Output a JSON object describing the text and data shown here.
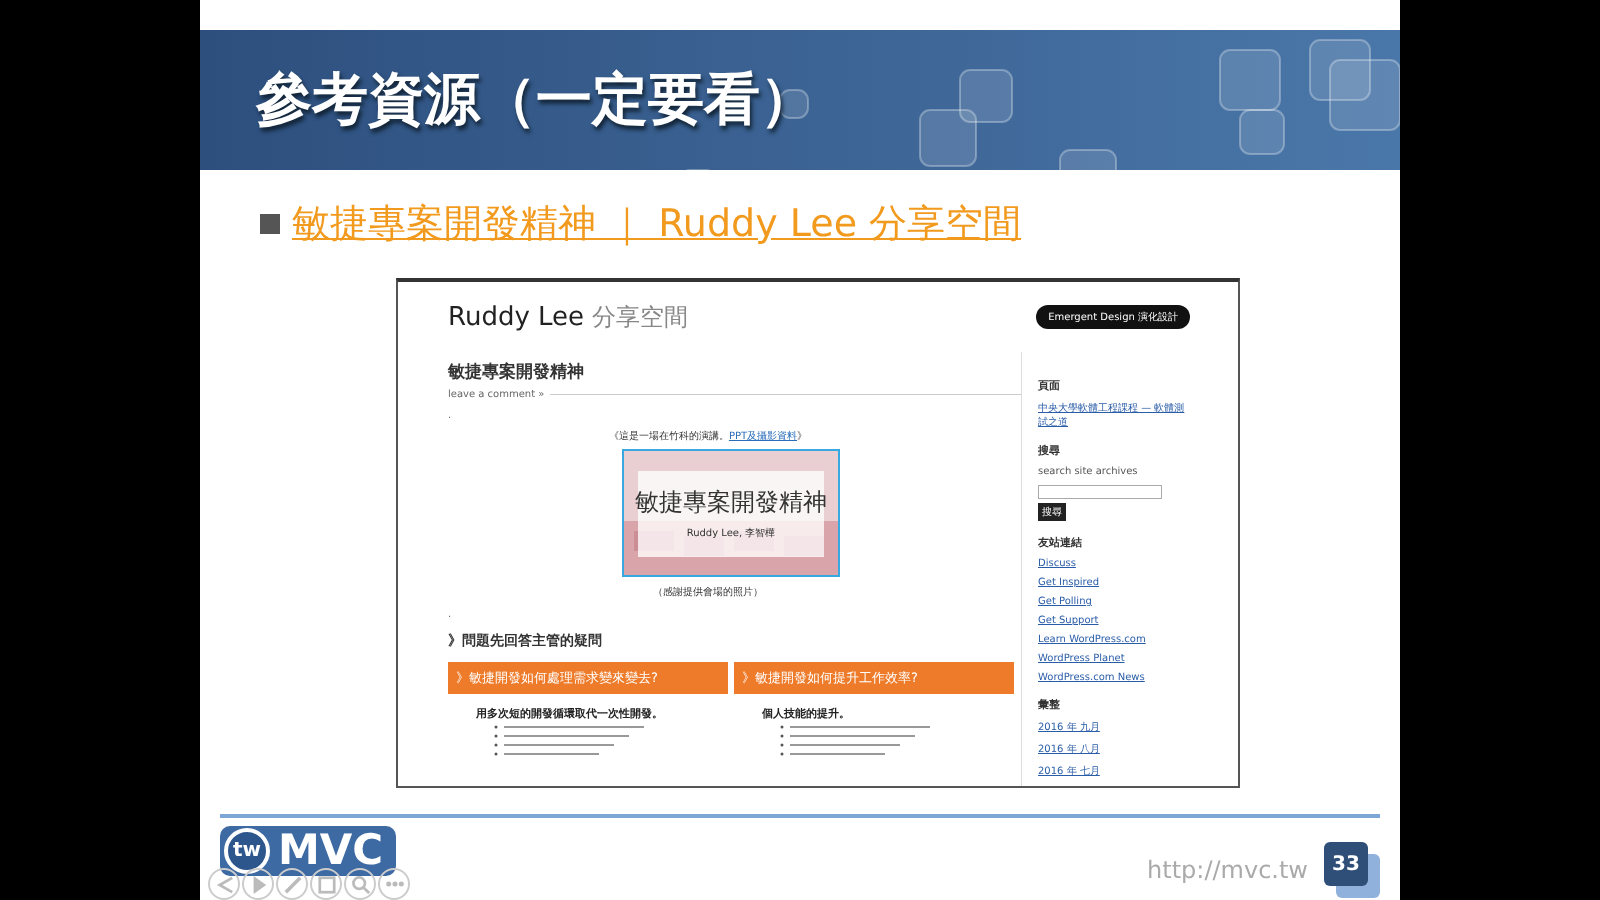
{
  "slide": {
    "title": "參考資源（一定要看）",
    "link": "敏捷專案開發精神 ｜ Ruddy Lee 分享空間"
  },
  "webpage": {
    "site_title": "Ruddy Lee",
    "site_subtitle": "分享空間",
    "badge": "Emergent Design 演化設計",
    "post_title": "敏捷專案開發精神",
    "comment_link": "leave a comment »",
    "dot_1": ".",
    "caption": "《這是一場在竹科的演講。",
    "caption_link": "PPT及攝影資料",
    "caption_end": "》",
    "image": {
      "title": "敏捷專案開發精神",
      "subtitle": "Ruddy Lee, 李智樺"
    },
    "image_caption": "（感謝提供會場的照片）",
    "dot_2": ".",
    "section_heading": "》問題先回答主管的疑問",
    "orange_buttons": [
      "》敏捷開發如何處理需求變來變去?",
      "》敏捷開發如何提升工作效率?"
    ],
    "columns": [
      {
        "heading": "用多次短的開發循環取代一次性開發。"
      },
      {
        "heading": "個人技能的提升。"
      }
    ],
    "sidebar": {
      "pages_heading": "頁面",
      "pages": [
        "中央大學軟體工程課程 — 軟體測試之道"
      ],
      "search_heading": "搜尋",
      "search_label": "search site archives",
      "search_button": "搜尋",
      "links_heading": "友站連結",
      "links": [
        "Discuss",
        "Get Inspired",
        "Get Polling",
        "Get Support",
        "Learn WordPress.com",
        "WordPress Planet",
        "WordPress.com News"
      ],
      "archive_heading": "彙整",
      "archives": [
        "2016 年 九月",
        "2016 年 八月",
        "2016 年 七月"
      ]
    }
  },
  "footer": {
    "logo_mark": "tw",
    "logo_text": "MVC",
    "url": "http://mvc.tw",
    "page_number": "33"
  },
  "viewer_controls": [
    {
      "kind": "previous"
    },
    {
      "kind": "next"
    },
    {
      "kind": "pen"
    },
    {
      "kind": "copy"
    },
    {
      "kind": "zoom"
    },
    {
      "kind": "more"
    }
  ]
}
